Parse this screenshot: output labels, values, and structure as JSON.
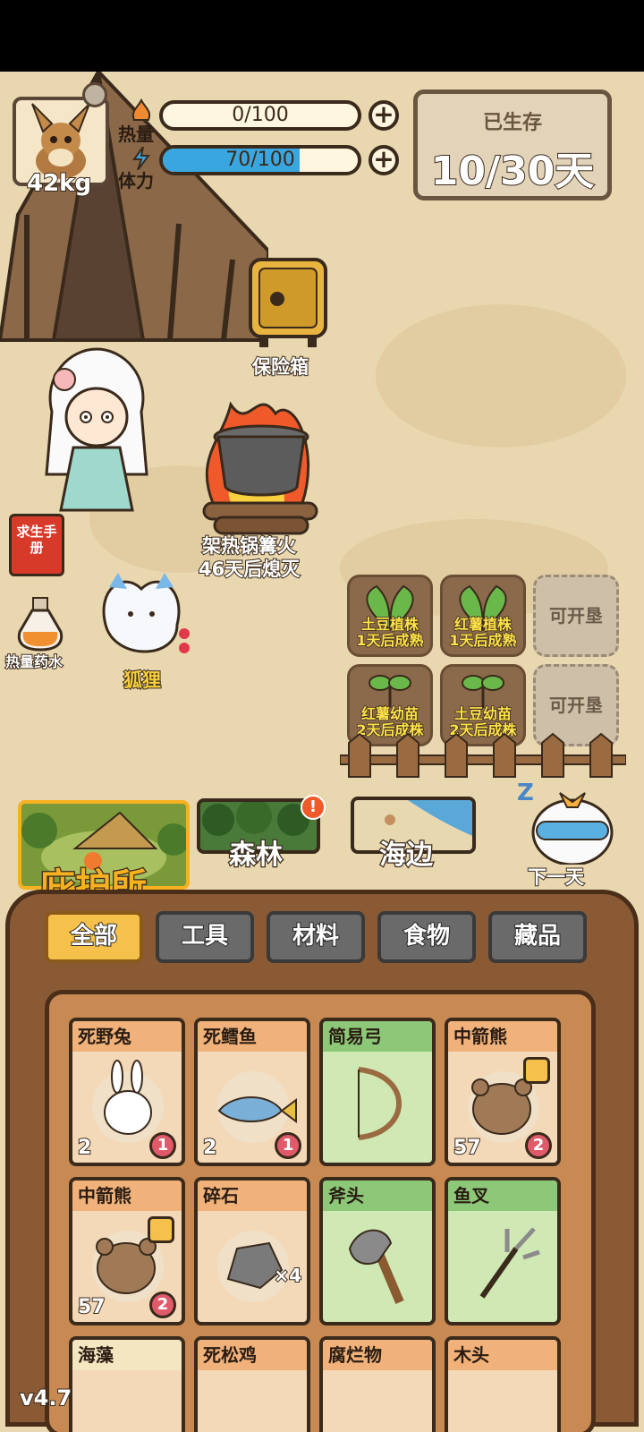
{
  "player": {
    "weight": "42kg",
    "heat_label": "热量",
    "heat_value": "0/100",
    "heat_fill": 0,
    "stamina_label": "体力",
    "stamina_value": "70/100",
    "stamina_fill": 0.7
  },
  "survival": {
    "label": "已生存",
    "days": "10/30天"
  },
  "scene": {
    "safe_label": "保险箱",
    "campfire_name": "架热锅篝火",
    "campfire_status": "46天后熄灭",
    "manual_label": "求生手册",
    "potion_label": "热量药水",
    "fox_label": "狐狸"
  },
  "farm": {
    "plots": [
      {
        "name": "土豆植株",
        "status": "1天后成熟"
      },
      {
        "name": "红薯植株",
        "status": "1天后成熟"
      },
      {
        "name": "可开垦",
        "status": ""
      },
      {
        "name": "红薯幼苗",
        "status": "2天后成株"
      },
      {
        "name": "土豆幼苗",
        "status": "2天后成株"
      },
      {
        "name": "可开垦",
        "status": ""
      }
    ]
  },
  "locations": {
    "shelter": "庇护所",
    "forest": "森林",
    "seaside": "海边",
    "next_day": "下一天"
  },
  "inventory": {
    "tabs": [
      "全部",
      "工具",
      "材料",
      "食物",
      "藏品"
    ],
    "items": [
      {
        "name": "死野兔",
        "count": "2",
        "level": "1",
        "type": "food"
      },
      {
        "name": "死鳕鱼",
        "count": "2",
        "level": "1",
        "type": "food"
      },
      {
        "name": "简易弓",
        "count": "",
        "level": "",
        "type": "tool"
      },
      {
        "name": "中箭熊",
        "count": "57",
        "level": "2",
        "type": "food"
      },
      {
        "name": "中箭熊",
        "count": "57",
        "level": "2",
        "type": "food"
      },
      {
        "name": "碎石",
        "count": "",
        "level": "",
        "qty": "×4",
        "type": "material"
      },
      {
        "name": "斧头",
        "count": "",
        "level": "",
        "type": "tool"
      },
      {
        "name": "鱼叉",
        "count": "",
        "level": "",
        "type": "tool"
      },
      {
        "name": "海藻",
        "count": "",
        "level": "",
        "type": "material"
      },
      {
        "name": "死松鸡",
        "count": "",
        "level": "",
        "type": "food"
      },
      {
        "name": "腐烂物",
        "count": "",
        "level": "",
        "type": "material"
      },
      {
        "name": "木头",
        "count": "",
        "level": "",
        "type": "material"
      }
    ]
  },
  "version": "v4.7"
}
